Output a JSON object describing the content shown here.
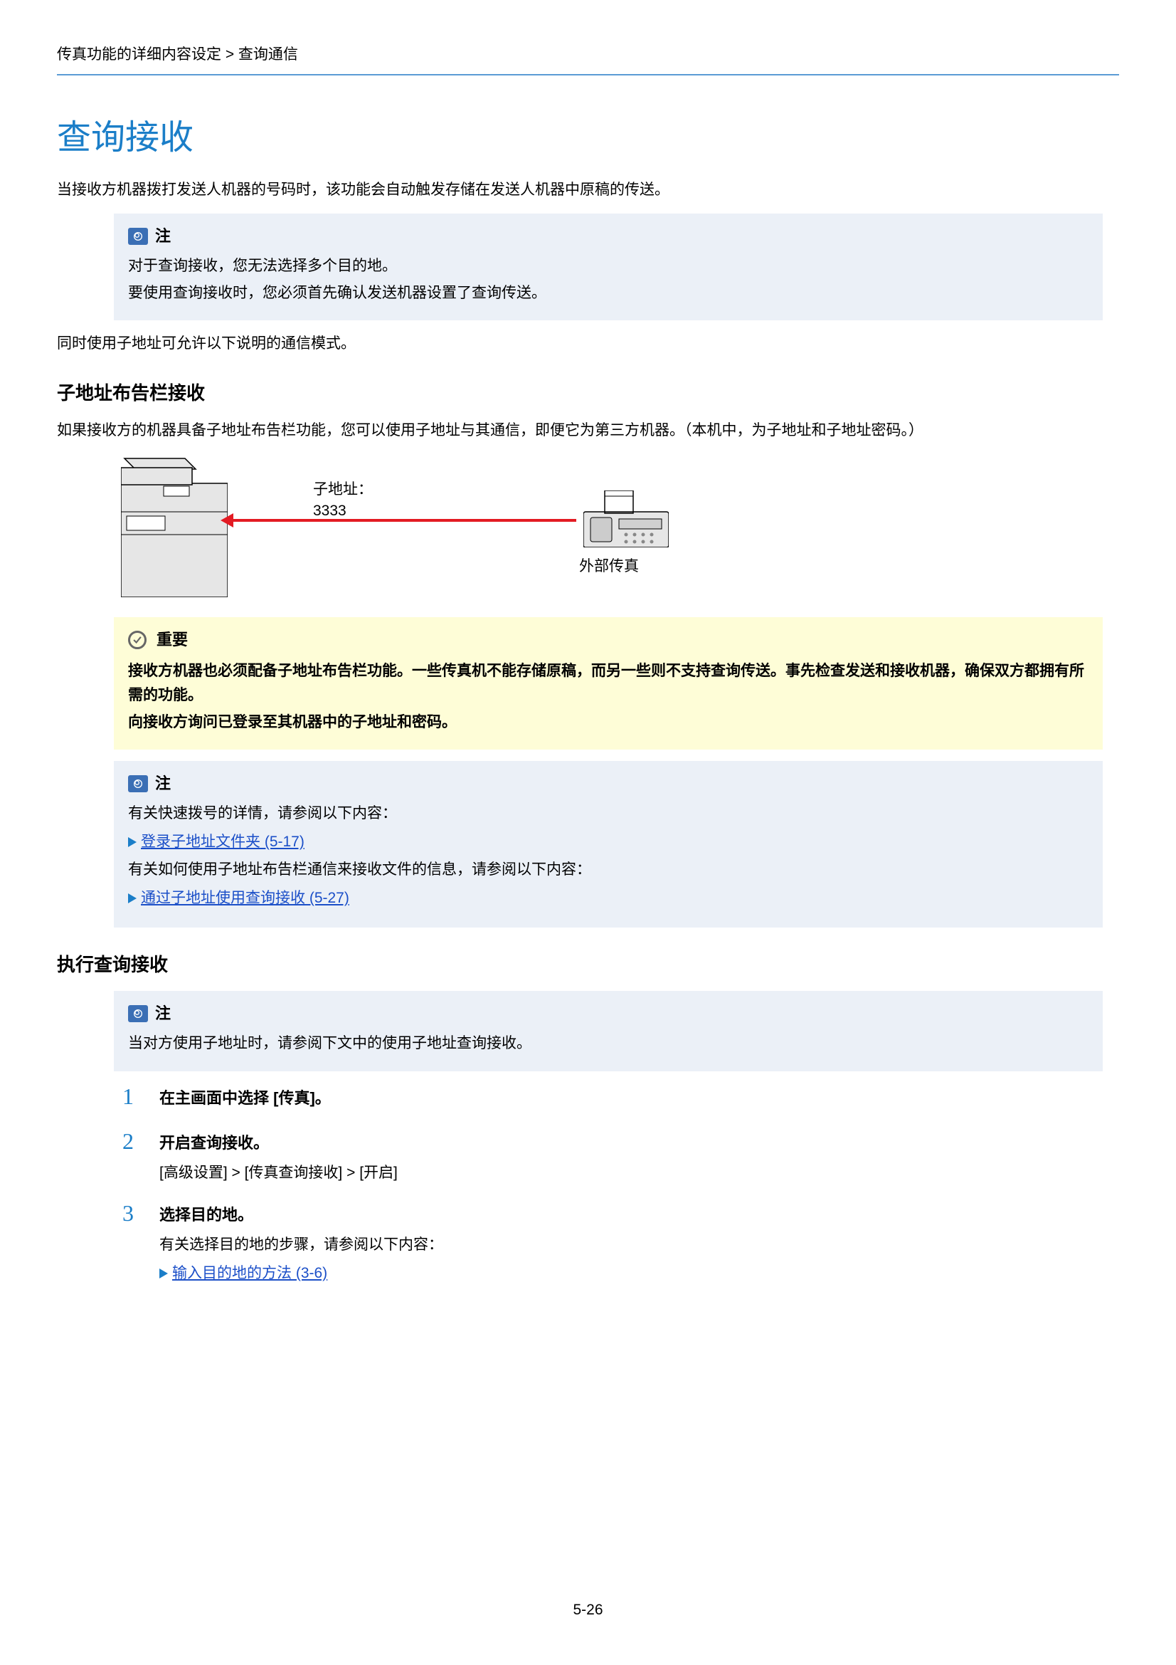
{
  "breadcrumb": "传真功能的详细内容设定 > 查询通信",
  "title": "查询接收",
  "intro": "当接收方机器拨打发送人机器的号码时，该功能会自动触发存储在发送人机器中原稿的传送。",
  "note1": {
    "title": "注",
    "lines": [
      "对于查询接收，您无法选择多个目的地。",
      "要使用查询接收时，您必须首先确认发送机器设置了查询传送。"
    ]
  },
  "para_after_note1": "同时使用子地址可允许以下说明的通信模式。",
  "sub1": "子地址布告栏接收",
  "sub1_para": "如果接收方的机器具备子地址布告栏功能，您可以使用子地址与其通信，即便它为第三方机器。（本机中，为子地址和子地址密码。）",
  "diagram": {
    "subaddr_label_l1": "子地址：",
    "subaddr_label_l2": "3333",
    "external_fax_label": "外部传真"
  },
  "important": {
    "title": "重要",
    "lines": [
      "接收方机器也必须配备子地址布告栏功能。一些传真机不能存储原稿，而另一些则不支持查询传送。事先检查发送和接收机器，确保双方都拥有所需的功能。",
      "向接收方询问已登录至其机器中的子地址和密码。"
    ]
  },
  "note2": {
    "title": "注",
    "line1": "有关快速拨号的详情，请参阅以下内容：",
    "link1": "登录子地址文件夹 (5-17)",
    "line2": "有关如何使用子地址布告栏通信来接收文件的信息，请参阅以下内容：",
    "link2": "通过子地址使用查询接收 (5-27)"
  },
  "sub2": "执行查询接收",
  "note3": {
    "title": "注",
    "line1": "当对方使用子地址时，请参阅下文中的使用子地址查询接收。"
  },
  "steps": [
    {
      "num": "1",
      "title": "在主画面中选择 [传真]。"
    },
    {
      "num": "2",
      "title": "开启查询接收。",
      "sub": "[高级设置] > [传真查询接收] > [开启]"
    },
    {
      "num": "3",
      "title": "选择目的地。",
      "sub": "有关选择目的地的步骤，请参阅以下内容：",
      "link": "输入目的地的方法 (3-6)"
    }
  ],
  "page_number": "5-26"
}
